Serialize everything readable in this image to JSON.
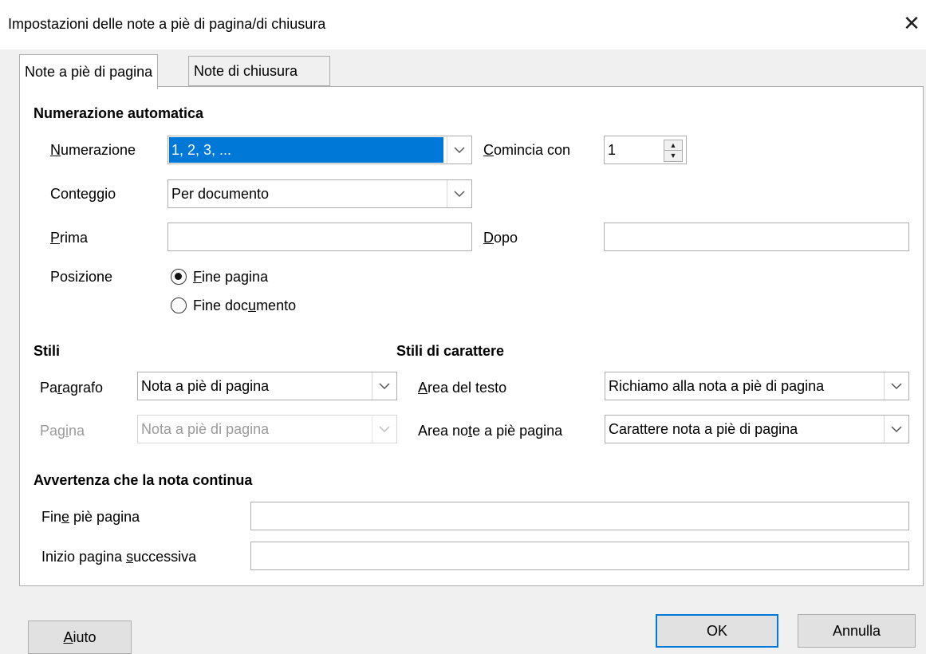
{
  "window": {
    "title": "Impostazioni delle note a piè di pagina/di chiusura",
    "close_glyph": "✕"
  },
  "tabs": [
    {
      "label": "Note a piè di pagina",
      "active": true
    },
    {
      "label": "Note di chiusura",
      "active": false
    }
  ],
  "auto_numbering": {
    "heading": "Numerazione automatica",
    "numbering_label": "Numerazione",
    "numbering_value": "1, 2, 3, ...",
    "start_label": "Comincia con",
    "start_value": "1",
    "count_label": "Conteggio",
    "count_value": "Per documento",
    "before_label": "Prima",
    "before_value": "",
    "after_label": "Dopo",
    "after_value": "",
    "position_label": "Posizione",
    "position_options": [
      "Fine pagina",
      "Fine documento"
    ],
    "position_selected": "Fine pagina"
  },
  "styles": {
    "heading": "Stili",
    "paragraph_label": "Paragrafo",
    "paragraph_value": "Nota a piè di pagina",
    "page_label": "Pagina",
    "page_value": "Nota a piè di pagina"
  },
  "char_styles": {
    "heading": "Stili di carattere",
    "text_area_label": "Area del testo",
    "text_area_value": "Richiamo alla nota a piè di pagina",
    "footnote_area_label": "Area note a piè pagina",
    "footnote_area_value": "Carattere nota a piè di pagina"
  },
  "continuation": {
    "heading": "Avvertenza che la nota continua",
    "end_label": "Fine piè pagina",
    "end_value": "",
    "next_label": "Inizio pagina successiva",
    "next_value": ""
  },
  "buttons": {
    "help": "Aiuto",
    "ok": "OK",
    "cancel": "Annulla"
  },
  "colors": {
    "accent": "#0078d7",
    "stripe": "#2bd36b"
  },
  "icons": {
    "dropdown": "chevron-down-icon",
    "spin": "spin-arrows-icon",
    "close": "close-icon"
  }
}
